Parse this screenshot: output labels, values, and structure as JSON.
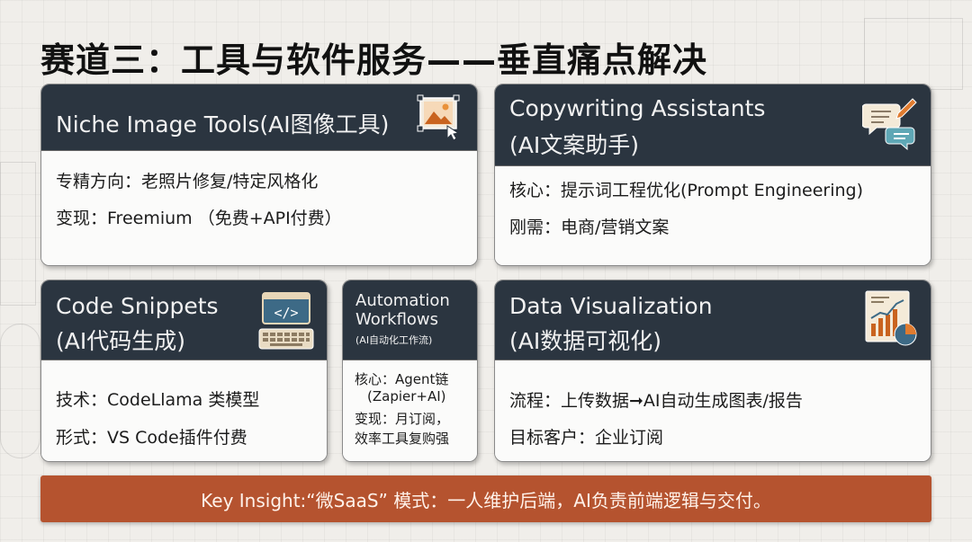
{
  "slide": {
    "title": "赛道三：工具与软件服务——垂直痛点解决"
  },
  "cards": {
    "image_tools": {
      "title": "Niche Image Tools(AI图像工具)",
      "icon": "image-edit-icon",
      "lines": [
        "专精方向：老照片修复/特定风格化",
        "变现：Freemium （免费+API付费）"
      ]
    },
    "copywriting": {
      "title_line1": "Copywriting Assistants",
      "title_line2": "(AI文案助手)",
      "icon": "chat-pen-icon",
      "lines": [
        "核心：提示词工程优化(Prompt   Engineering)",
        "刚需：电商/营销文案"
      ]
    },
    "code": {
      "title_line1": "Code Snippets",
      "title_line2": "(AI代码生成)",
      "icon": "code-keyboard-icon",
      "lines": [
        "技术：CodeLlama 类模型",
        "形式：VS Code插件付费"
      ]
    },
    "automation": {
      "title_line1": "Automation",
      "title_line2": "Workflows",
      "subtitle": "(AI自动化工作流)",
      "lines": [
        "核心：Agent链",
        "(Zapier+AI)",
        "变现：月订阅，",
        "效率工具复购强"
      ]
    },
    "dataviz": {
      "title_line1": "Data Visualization",
      "title_line2": "(AI数据可视化)",
      "icon": "chart-report-icon",
      "lines": [
        "流程：上传数据➞AI自动生成图表/报告",
        "目标客户：企业订阅"
      ]
    }
  },
  "insight": {
    "text": "Key   Insight:“微SaaS” 模式：一人维护后端，AI负责前端逻辑与交付。"
  },
  "colors": {
    "header_dark": "#2b3540",
    "insight_bar": "#b5532f",
    "background": "#f0eeea"
  }
}
